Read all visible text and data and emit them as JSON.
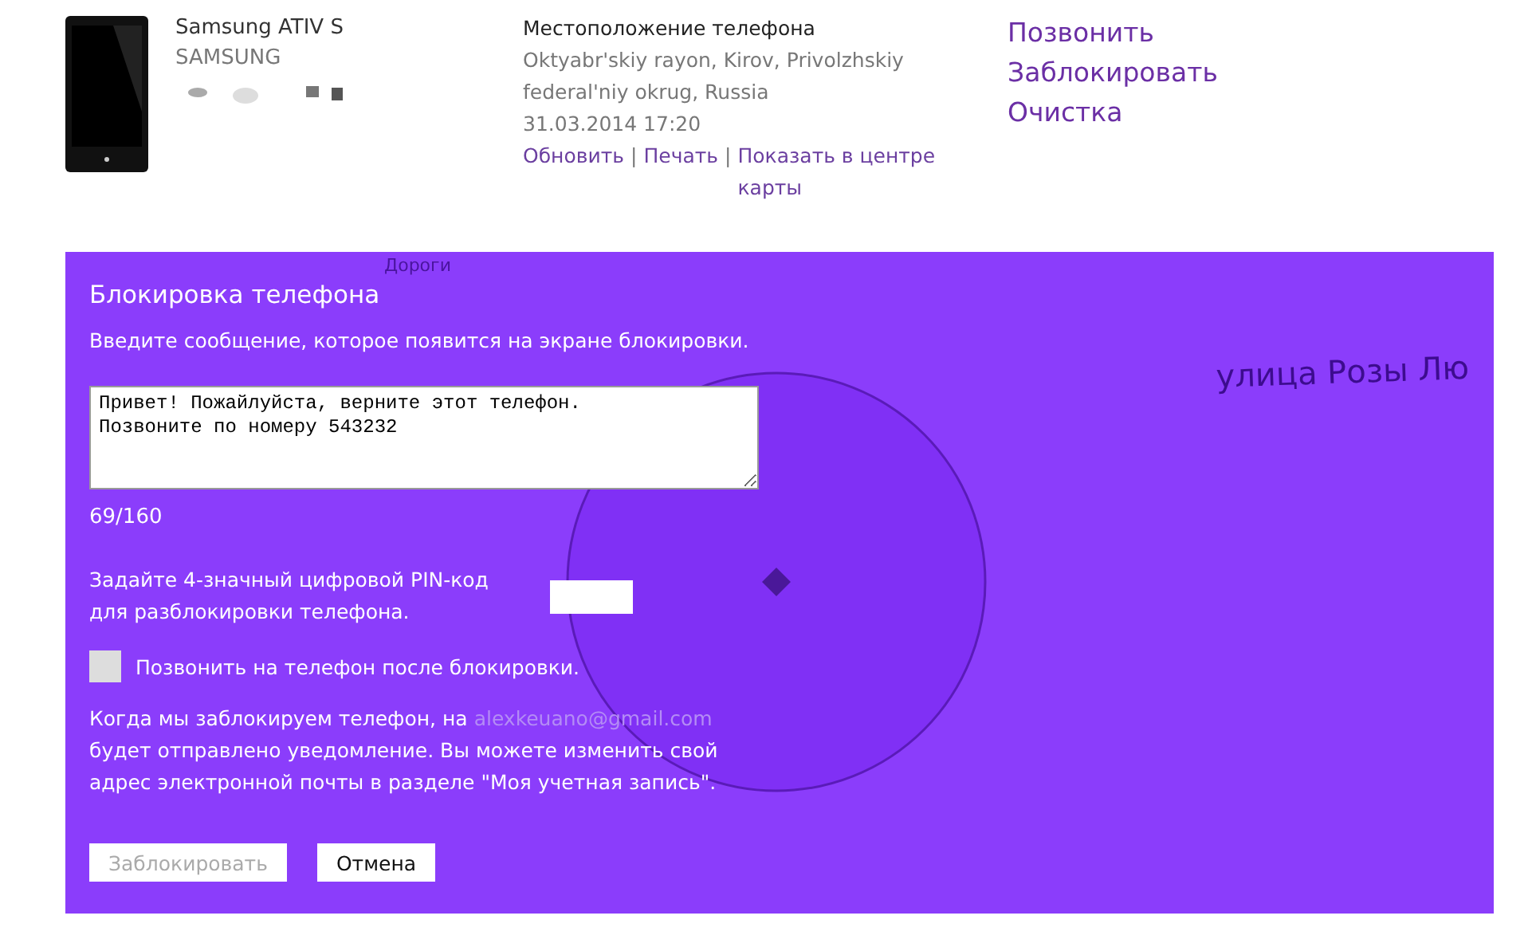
{
  "device": {
    "name": "Samsung ATIV S",
    "maker": "SAMSUNG"
  },
  "location": {
    "heading": "Местоположение телефона",
    "address": "Oktyabr'skiy rayon, Kirov, Privolzhskiy federal'niy okrug, Russia",
    "timestamp": "31.03.2014 17:20",
    "links": [
      "Обновить",
      "Печать",
      "Показать в центре карты"
    ],
    "separator": "|"
  },
  "actions": [
    "Позвонить",
    "Заблокировать",
    "Очистка"
  ],
  "map": {
    "style_label": "Дороги",
    "street_label": "улица Розы Лю"
  },
  "lock_dialog": {
    "title": "Блокировка телефона",
    "instruction": "Введите сообщение, которое появится на экране блокировки.",
    "message": "Привет! Пожайлуйста, верните этот телефон.\nПозвоните по номеру 543232",
    "counter": "69/160",
    "pin_label": "Задайте 4-значный цифровой PIN-код для разблокировки телефона.",
    "call_after": {
      "label": "Позвонить на телефон после блокировки.",
      "checked": false
    },
    "notice": {
      "before": "Когда мы заблокируем телефон, на ",
      "email": "alexkeuano@gmail.com",
      "after": " будет отправлено уведомление. Вы можете изменить свой адрес электронной почты в разделе \"Моя учетная запись\"."
    },
    "buttons": [
      {
        "label": "Заблокировать",
        "disabled": true
      },
      {
        "label": "Отмена",
        "disabled": false
      }
    ]
  }
}
